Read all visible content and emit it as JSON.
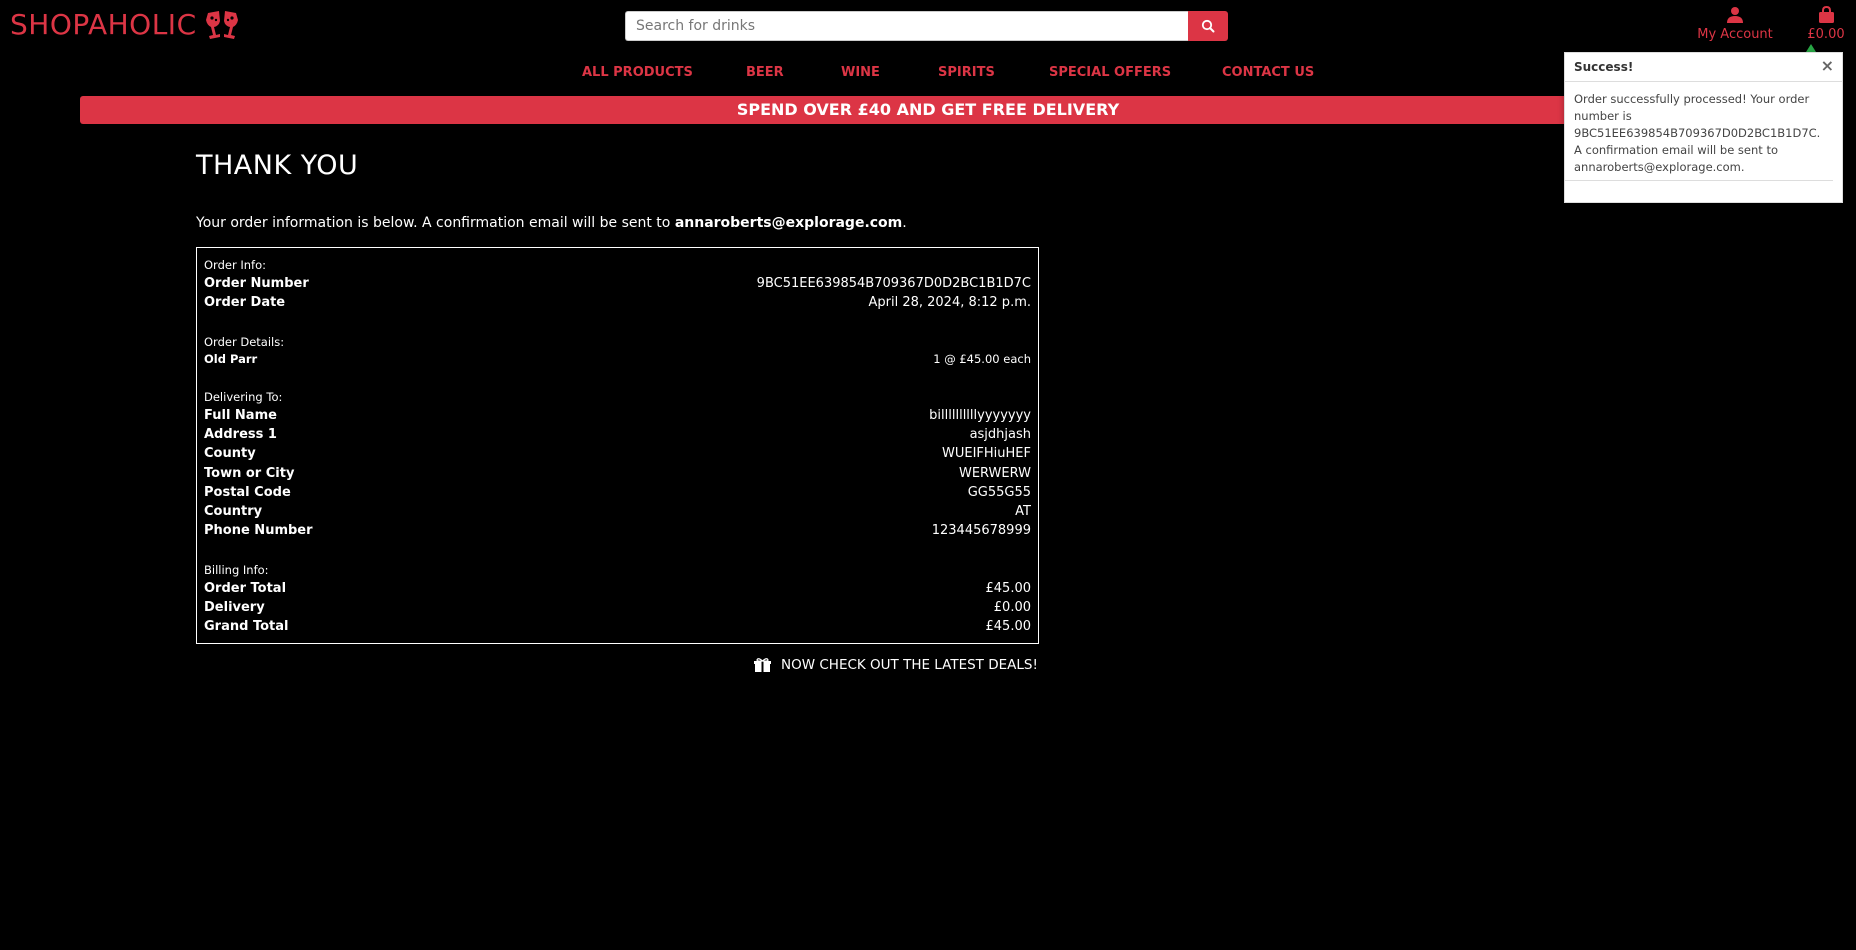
{
  "brand": {
    "name": "SHOPAHOLIC",
    "accent": "#dc3545"
  },
  "search": {
    "placeholder": "Search for drinks",
    "icon": "search-icon"
  },
  "header": {
    "account_label": "My Account",
    "cart_total": "£0.00"
  },
  "nav": {
    "items": [
      "ALL PRODUCTS",
      "BEER",
      "WINE",
      "SPIRITS",
      "SPECIAL OFFERS",
      "CONTACT US"
    ]
  },
  "promo": {
    "text": "SPEND OVER £40 AND GET FREE DELIVERY"
  },
  "toast": {
    "title": "Success!",
    "close": "×",
    "message": "Order successfully processed! Your order number is 9BC51EE639854B709367D0D2BC1B1D7C. A confirmation email will be sent to annaroberts@explorage.com."
  },
  "page": {
    "title": "THANK YOU",
    "intro_prefix": "Your order information is below. A confirmation email will be sent to ",
    "email": "annaroberts@explorage.com",
    "intro_suffix": "."
  },
  "order": {
    "info_heading": "Order Info:",
    "number_label": "Order Number",
    "number_value": "9BC51EE639854B709367D0D2BC1B1D7C",
    "date_label": "Order Date",
    "date_value": "April 28, 2024, 8:12 p.m.",
    "details_heading": "Order Details:",
    "item_name": "Old Parr",
    "item_qty": "1 @ £45.00 each",
    "delivery_heading": "Delivering To:",
    "delivery": [
      {
        "label": "Full Name",
        "value": "billllllllllyyyyyyy"
      },
      {
        "label": "Address 1",
        "value": "asjdhjash"
      },
      {
        "label": "County",
        "value": "WUEIFHiuHEF"
      },
      {
        "label": "Town or City",
        "value": "WERWERW"
      },
      {
        "label": "Postal Code",
        "value": "GG55G55"
      },
      {
        "label": "Country",
        "value": "AT"
      },
      {
        "label": "Phone Number",
        "value": "123445678999"
      }
    ],
    "billing_heading": "Billing Info:",
    "billing": [
      {
        "label": "Order Total",
        "value": "£45.00"
      },
      {
        "label": "Delivery",
        "value": "£0.00"
      },
      {
        "label": "Grand Total",
        "value": "£45.00"
      }
    ]
  },
  "deals": {
    "label": "NOW CHECK OUT THE LATEST DEALS!"
  }
}
